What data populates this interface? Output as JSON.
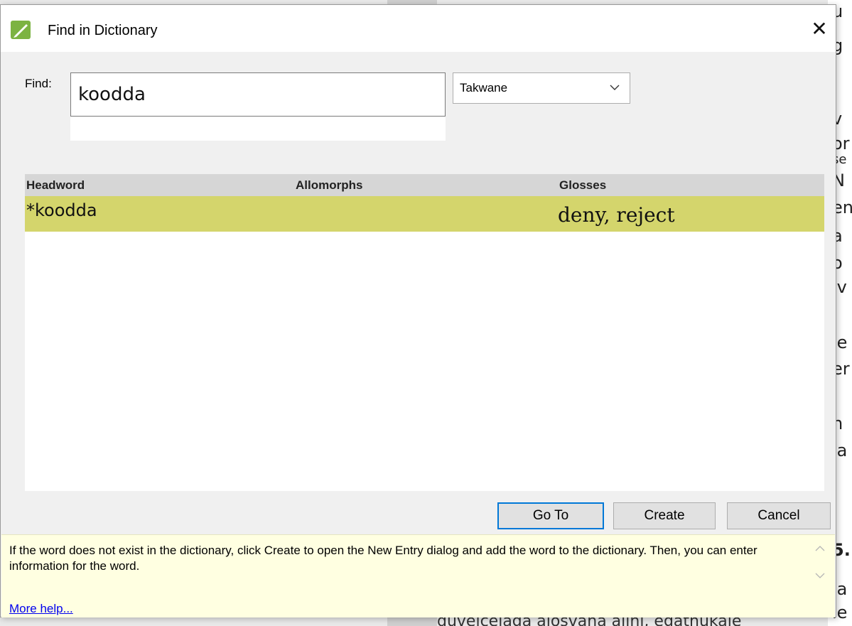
{
  "dialog": {
    "title": "Find in Dictionary",
    "close_glyph": "✕"
  },
  "find": {
    "label": "Find:",
    "value": "koodda",
    "writing_system": "Takwane"
  },
  "results": {
    "columns": [
      "Headword",
      "Allomorphs",
      "Glosses"
    ],
    "rows": [
      {
        "headword": "*koodda",
        "allomorphs": "",
        "glosses": "deny, reject"
      }
    ],
    "selected_color": "#d4d56c"
  },
  "buttons": {
    "goto": "Go To",
    "create": "Create",
    "cancel": "Cancel"
  },
  "help": {
    "text": "If the word does not exist in the dictionary, click Create to open the New Entry dialog and add the word to the dictionary. Then, you can enter information for the word.",
    "link": "More help..."
  },
  "background": {
    "fragments": [
      "u",
      "g",
      ".",
      "v",
      "or",
      "se",
      "N",
      "en",
      "a",
      "o",
      "iv",
      "le",
      "er",
      "h",
      "la",
      "5.",
      "ja",
      "le"
    ],
    "bottom_text": "duvelcelaga aiosvana ajinj, egatnukale"
  }
}
